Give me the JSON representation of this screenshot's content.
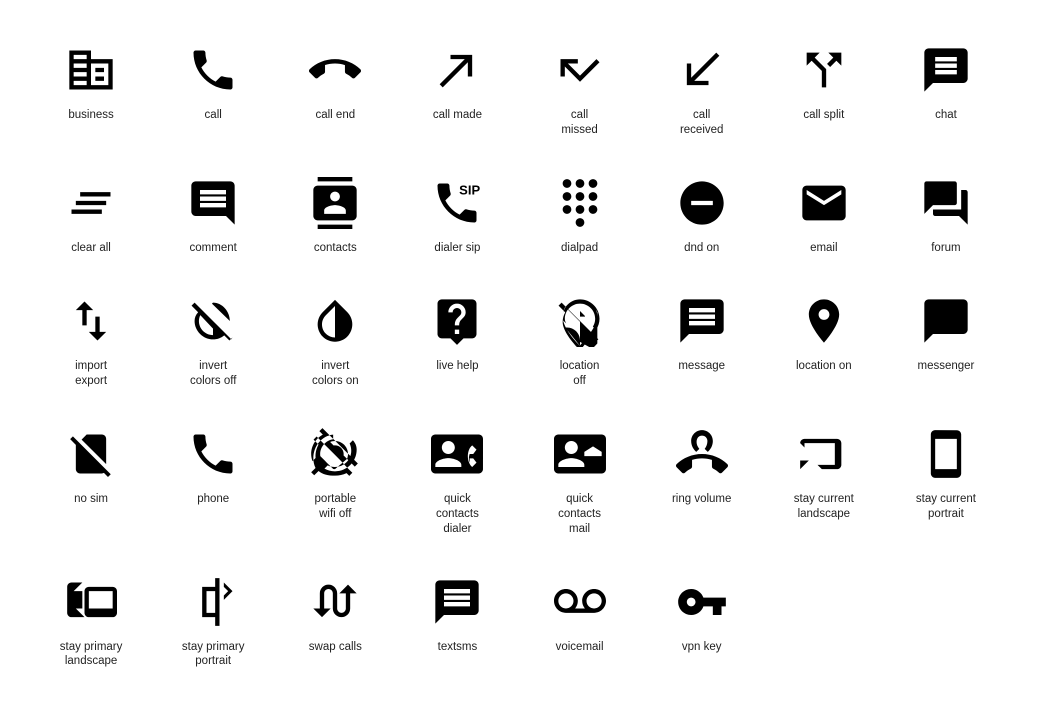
{
  "icons": [
    {
      "name": "business",
      "label": "business"
    },
    {
      "name": "call",
      "label": "call"
    },
    {
      "name": "call-end",
      "label": "call end"
    },
    {
      "name": "call-made",
      "label": "call made"
    },
    {
      "name": "call-missed",
      "label": "call\nmissed"
    },
    {
      "name": "call-received",
      "label": "call\nreceived"
    },
    {
      "name": "call-split",
      "label": "call split"
    },
    {
      "name": "chat",
      "label": "chat"
    },
    {
      "name": "clear-all",
      "label": "clear all"
    },
    {
      "name": "comment",
      "label": "comment"
    },
    {
      "name": "contacts",
      "label": "contacts"
    },
    {
      "name": "dialer-sip",
      "label": "dialer sip"
    },
    {
      "name": "dialpad",
      "label": "dialpad"
    },
    {
      "name": "dnd-on",
      "label": "dnd on"
    },
    {
      "name": "email",
      "label": "email"
    },
    {
      "name": "forum",
      "label": "forum"
    },
    {
      "name": "import-export",
      "label": "import\nexport"
    },
    {
      "name": "invert-colors-off",
      "label": "invert\ncolors off"
    },
    {
      "name": "invert-colors-on",
      "label": "invert\ncolors on"
    },
    {
      "name": "live-help",
      "label": "live help"
    },
    {
      "name": "location-off",
      "label": "location\noff"
    },
    {
      "name": "message",
      "label": "message"
    },
    {
      "name": "location-on",
      "label": "location on"
    },
    {
      "name": "messenger",
      "label": "messenger"
    },
    {
      "name": "no-sim",
      "label": "no sim"
    },
    {
      "name": "phone",
      "label": "phone"
    },
    {
      "name": "portable-wifi-off",
      "label": "portable\nwifi off"
    },
    {
      "name": "quick-contacts-dialer",
      "label": "quick\ncontacts\ndialer"
    },
    {
      "name": "quick-contacts-mail",
      "label": "quick\ncontacts\nmail"
    },
    {
      "name": "ring-volume",
      "label": "ring volume"
    },
    {
      "name": "stay-current-landscape",
      "label": "stay current\nlandscape"
    },
    {
      "name": "stay-current-portrait",
      "label": "stay current\nportrait"
    },
    {
      "name": "stay-primary-landscape",
      "label": "stay primary\nlandscape"
    },
    {
      "name": "stay-primary-portrait",
      "label": "stay primary\nportrait"
    },
    {
      "name": "swap-calls",
      "label": "swap calls"
    },
    {
      "name": "textsms",
      "label": "textsms"
    },
    {
      "name": "voicemail",
      "label": "voicemail"
    },
    {
      "name": "vpn-key",
      "label": "vpn key"
    }
  ]
}
